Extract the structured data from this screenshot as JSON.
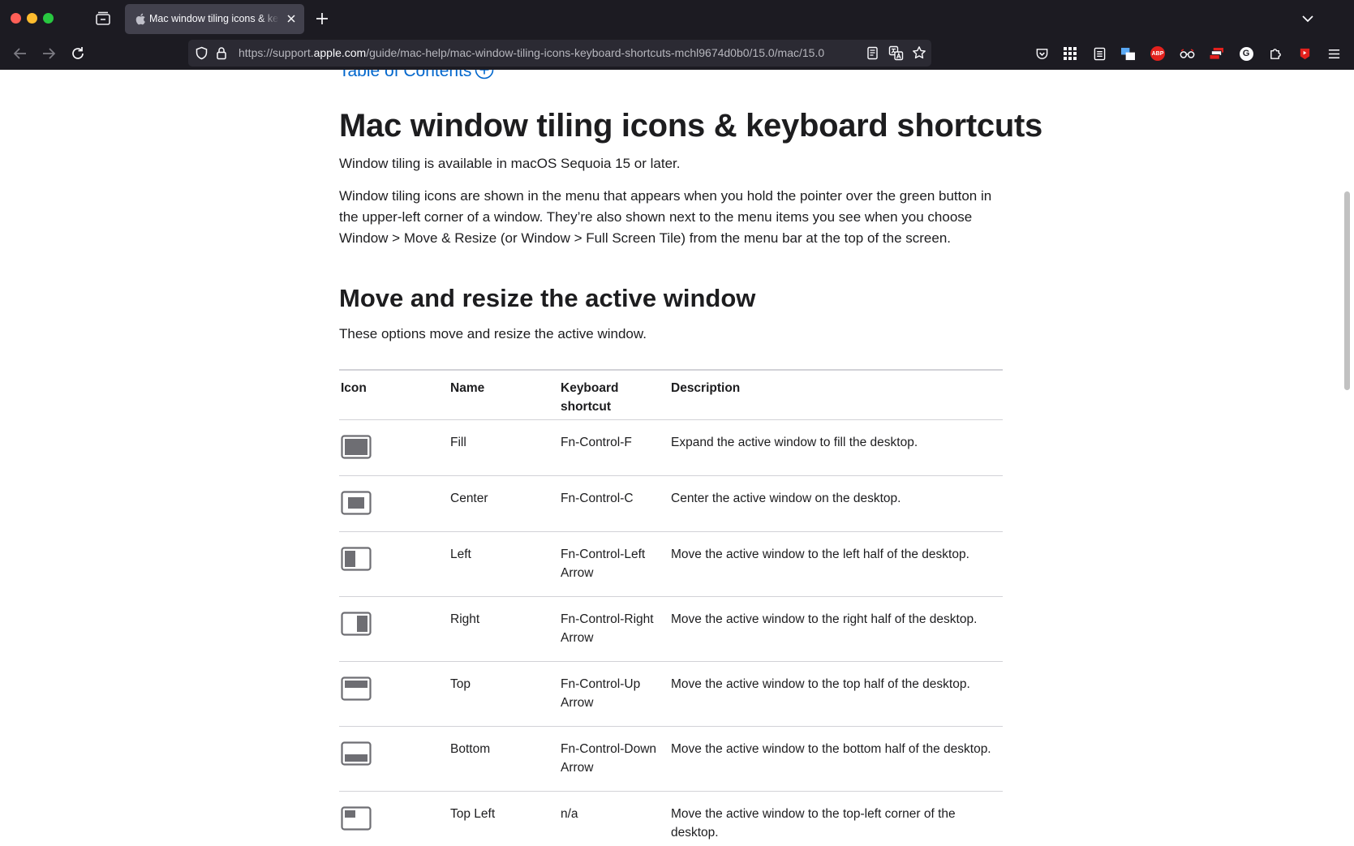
{
  "browser": {
    "tab_title": "Mac window tiling icons & keyboard shortcuts",
    "url_prefix": "https://support.",
    "url_domain": "apple.com",
    "url_path": "/guide/mac-help/mac-window-tiling-icons-keyboard-shortcuts-mchl9674d0b0/15.0/mac/15.0",
    "toolbar_icons": [
      "pocket-icon",
      "apps-grid-icon",
      "notes-icon",
      "windows-icon",
      "adblock-plus-icon",
      "glasses-icon",
      "stack-icon",
      "grammarly-icon",
      "extensions-icon",
      "youtube-icon",
      "menu-icon"
    ],
    "abp_label": "ABP",
    "g_label": "G"
  },
  "article": {
    "toc_label": "Table of Contents",
    "title": "Mac window tiling icons & keyboard shortcuts",
    "availability": "Window tiling is available in macOS Sequoia 15 or later.",
    "intro": "Window tiling icons are shown in the menu that appears when you hold the pointer over the green button in the upper-left corner of a window. They’re also shown next to the menu items you see when you choose Window > Move & Resize (or Window > Full Screen Tile) from the menu bar at the top of the screen.",
    "section_title": "Move and resize the active window",
    "section_intro": "These options move and resize the active window.",
    "table": {
      "headers": {
        "icon": "Icon",
        "name": "Name",
        "shortcut": "Keyboard shortcut",
        "description": "Description"
      },
      "rows": [
        {
          "icon": "fill-icon",
          "name": "Fill",
          "shortcut": "Fn-Control-F",
          "description": "Expand the active window to fill the desktop."
        },
        {
          "icon": "center-icon",
          "name": "Center",
          "shortcut": "Fn-Control-C",
          "description": "Center the active window on the desktop."
        },
        {
          "icon": "left-half-icon",
          "name": "Left",
          "shortcut": "Fn-Control-Left Arrow",
          "description": "Move the active window to the left half of the desktop."
        },
        {
          "icon": "right-half-icon",
          "name": "Right",
          "shortcut": "Fn-Control-Right Arrow",
          "description": "Move the active window to the right half of the desktop."
        },
        {
          "icon": "top-half-icon",
          "name": "Top",
          "shortcut": "Fn-Control-Up Arrow",
          "description": "Move the active window to the top half of the desktop."
        },
        {
          "icon": "bottom-half-icon",
          "name": "Bottom",
          "shortcut": "Fn-Control-Down Arrow",
          "description": "Move the active window to the bottom half of the desktop."
        },
        {
          "icon": "top-left-icon",
          "name": "Top Left",
          "shortcut": "n/a",
          "description": "Move the active window to the top-left corner of the desktop."
        }
      ]
    }
  },
  "colors": {
    "chrome_bg": "#1c1b22",
    "tab_bg": "#42414d",
    "urlbar_bg": "#2b2a33",
    "link": "#0066cc",
    "text": "#1d1d1f",
    "icon_gray": "#6e6e73"
  }
}
